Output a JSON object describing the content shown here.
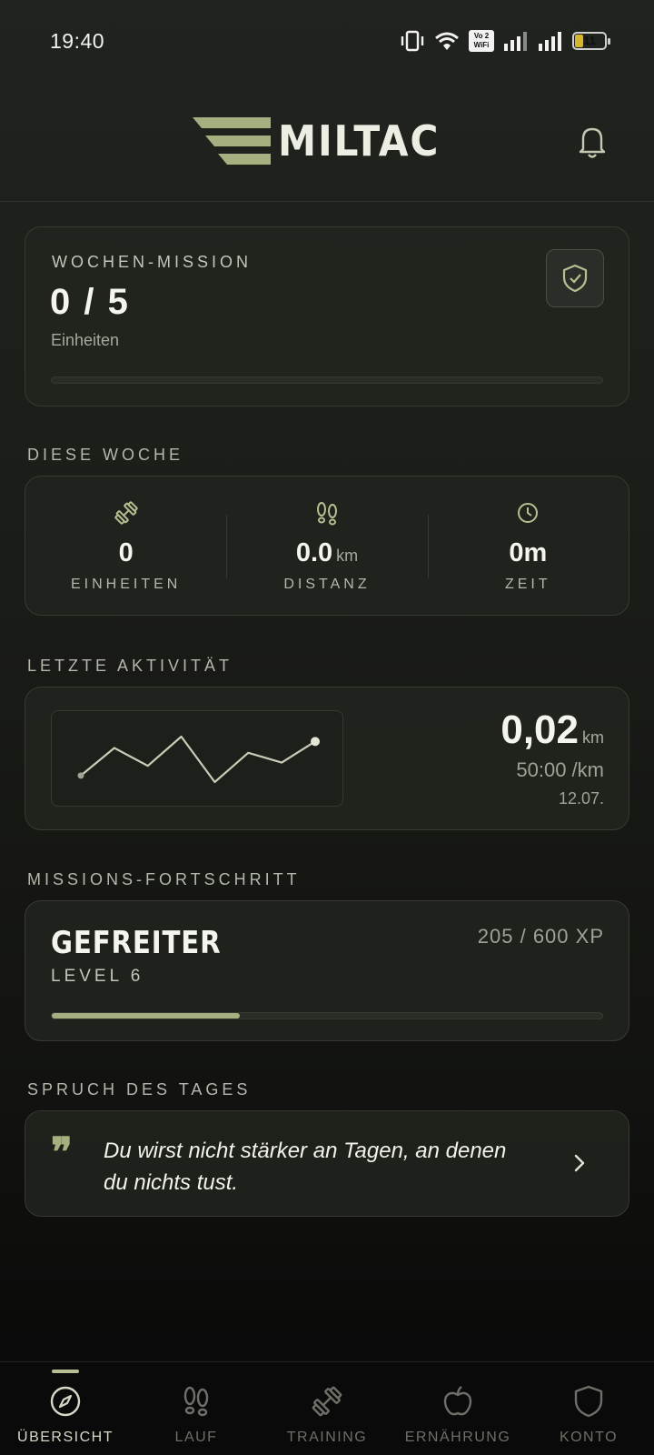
{
  "status_bar": {
    "time": "19:40",
    "vowifi_top": "Vo 2",
    "vowifi_bottom": "WiFi",
    "battery": "11"
  },
  "header": {
    "app_name": "MILTAC",
    "bell_icon": "bell-icon"
  },
  "mission": {
    "title": "WOCHEN-MISSION",
    "count": "0 / 5",
    "unit": "Einheiten",
    "progress": 0,
    "badge_icon": "shield-check-icon"
  },
  "week": {
    "section_label": "DIESE WOCHE",
    "stats": [
      {
        "icon": "dumbbell-icon",
        "value": "0",
        "unit": "",
        "label": "EINHEITEN"
      },
      {
        "icon": "footprints-icon",
        "value": "0.0",
        "unit": "km",
        "label": "DISTANZ"
      },
      {
        "icon": "clock-icon",
        "value": "0m",
        "unit": "",
        "label": "ZEIT"
      }
    ]
  },
  "activity": {
    "section_label": "LETZTE AKTIVITÄT",
    "distance": "0,02",
    "distance_unit": "km",
    "pace": "50:00 /km",
    "date": "12.07.",
    "chart_data": {
      "type": "line",
      "values": [
        0,
        17,
        6,
        24,
        -4,
        14,
        8,
        21
      ]
    }
  },
  "rank": {
    "section_label": "MISSIONS-FORTSCHRITT",
    "name": "GEFREITER",
    "level": "LEVEL 6",
    "xp": "205 / 600 XP",
    "progress": 0.342
  },
  "quote": {
    "section_label": "SPRUCH DES TAGES",
    "mark": "❞",
    "text": "Du wirst nicht stärker an Tagen, an denen du nichts tust.",
    "chevron_icon": "chevron-right-icon"
  },
  "nav": {
    "active": 0,
    "items": [
      {
        "label": "ÜBERSICHT",
        "icon": "compass-icon"
      },
      {
        "label": "LAUF",
        "icon": "footprints-icon"
      },
      {
        "label": "TRAINING",
        "icon": "dumbbell-icon"
      },
      {
        "label": "ERNÄHRUNG",
        "icon": "apple-icon"
      },
      {
        "label": "KONTO",
        "icon": "shield-icon"
      }
    ]
  },
  "colors": {
    "accent": "#a4b080",
    "background": "#1a1c18",
    "card": "#22251f",
    "text": "#f4f5ee"
  }
}
